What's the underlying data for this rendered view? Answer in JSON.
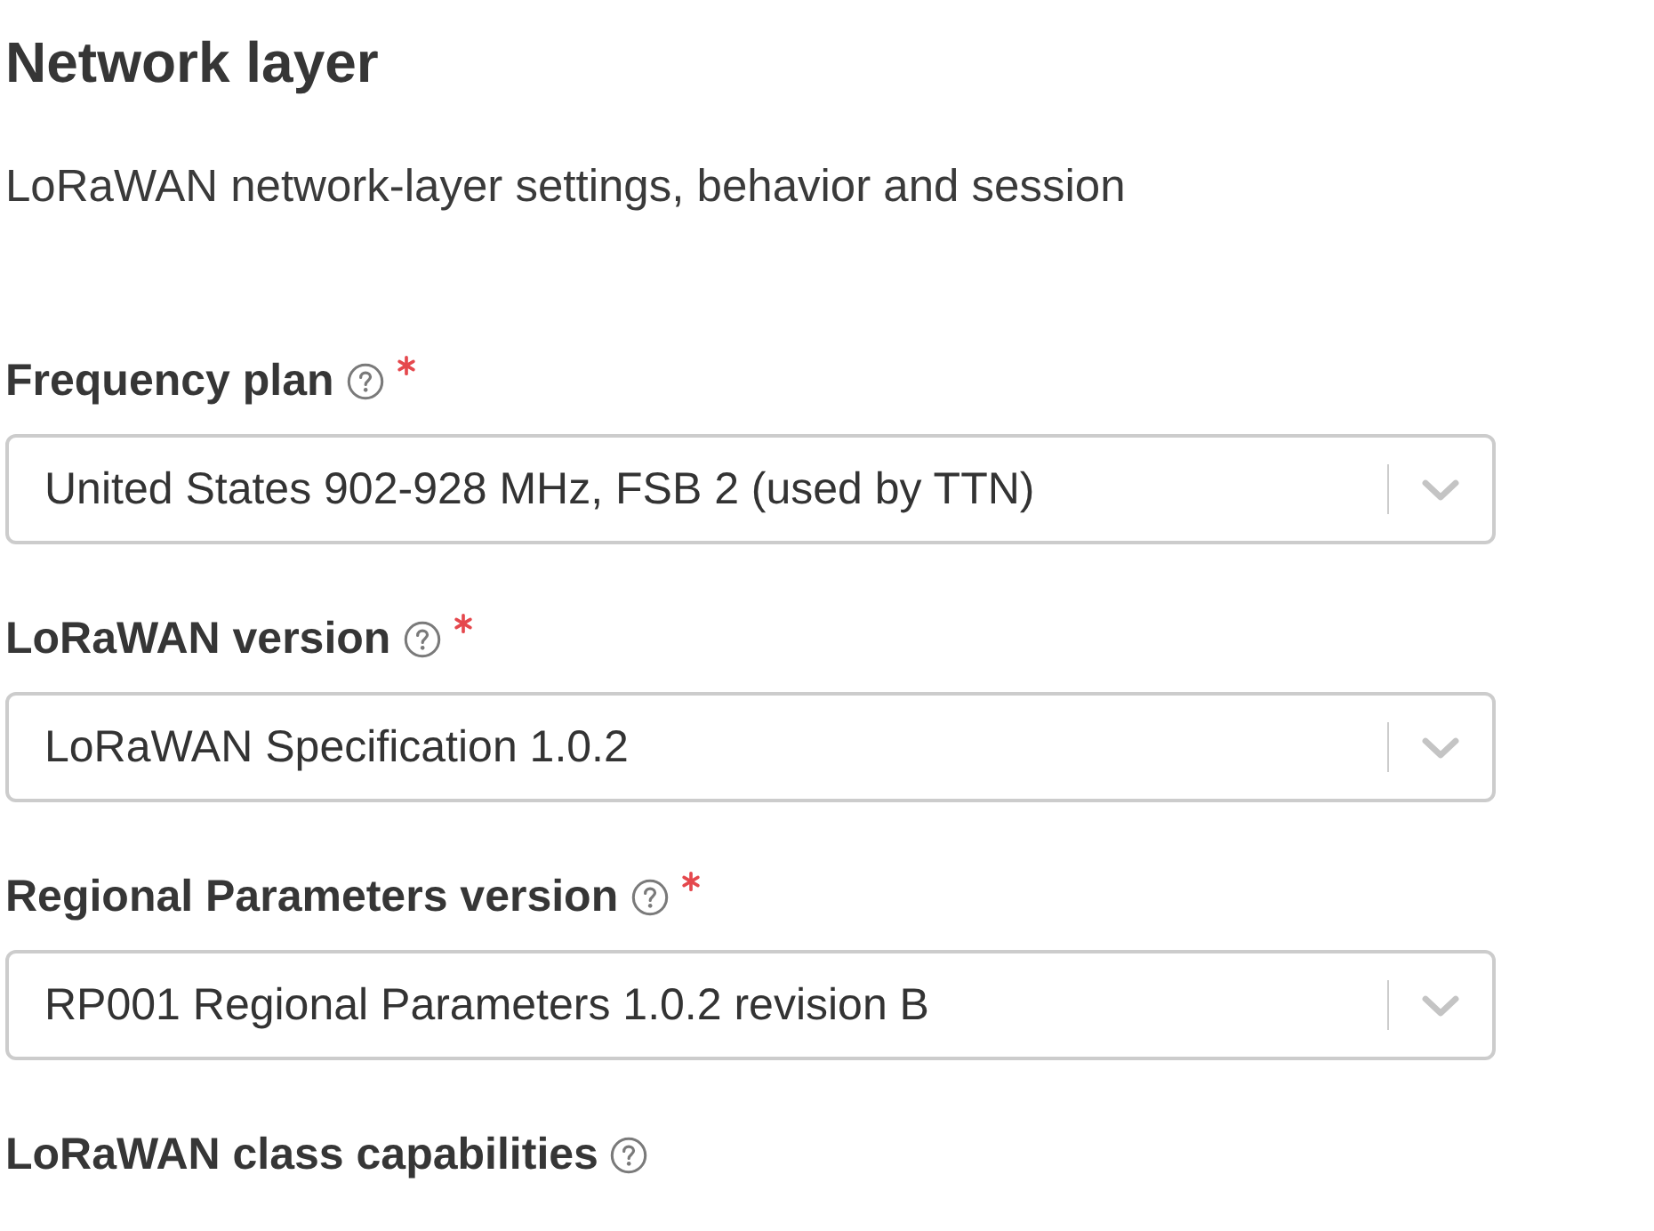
{
  "heading": "Network layer",
  "description": "LoRaWAN network-layer settings, behavior and session",
  "fields": [
    {
      "label": "Frequency plan",
      "required": true,
      "value": "United States 902-928 MHz, FSB 2 (used by TTN)"
    },
    {
      "label": "LoRaWAN version",
      "required": true,
      "value": "LoRaWAN Specification 1.0.2"
    },
    {
      "label": "Regional Parameters version",
      "required": true,
      "value": "RP001 Regional Parameters 1.0.2 revision B"
    },
    {
      "label": "LoRaWAN class capabilities",
      "required": false
    }
  ]
}
